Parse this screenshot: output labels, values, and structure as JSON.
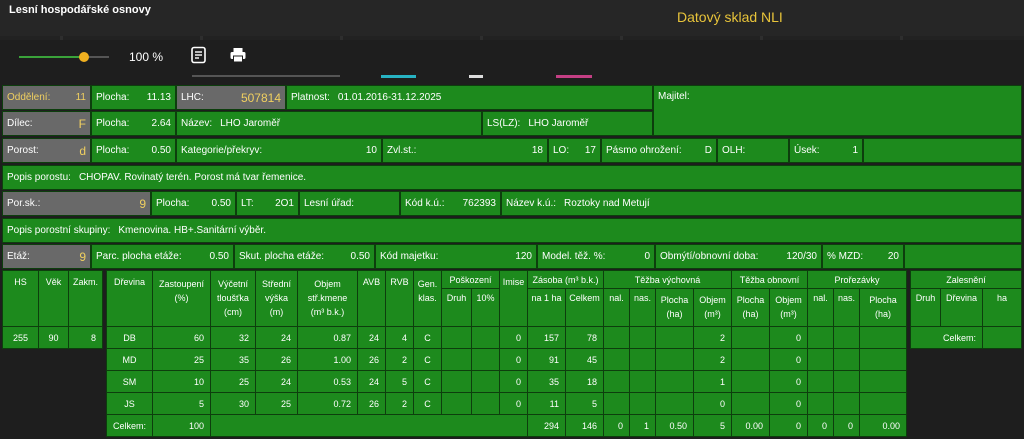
{
  "header": {
    "app_title": "Lesní hospodářské osnovy",
    "nli_title": "Datový sklad NLI"
  },
  "toolbar": {
    "zoom": "100 %",
    "zoom_fraction": 0.72,
    "notes_icon": "notes-icon",
    "print_icon": "print-icon"
  },
  "row1": {
    "oddeleni_label": "Oddělení:",
    "oddeleni": "11",
    "plocha_label": "Plocha:",
    "plocha": "11.13",
    "lhc_label": "LHC:",
    "lhc": "507814",
    "platnost_label": "Platnost:",
    "platnost": "01.01.2016-31.12.2025",
    "majitel_label": "Majitel:"
  },
  "row2": {
    "dilec_label": "Dílec:",
    "dilec": "F",
    "plocha_label": "Plocha:",
    "plocha": "2.64",
    "nazev_label": "Název:",
    "nazev": "LHO Jaroměř",
    "lslz_label": "LS(LZ):",
    "lslz": "LHO Jaroměř"
  },
  "row3": {
    "porost_label": "Porost:",
    "porost": "d",
    "plocha_label": "Plocha:",
    "plocha": "0.50",
    "kategorie_label": "Kategorie/překryv:",
    "kategorie": "10",
    "zvlst_label": "Zvl.st.:",
    "zvlst": "18",
    "lo_label": "LO:",
    "lo": "17",
    "pasmo_label": "Pásmo ohrožení:",
    "pasmo": "D",
    "olh_label": "OLH:",
    "usek_label": "Úsek:",
    "usek": "1"
  },
  "row4": {
    "popis_label": "Popis porostu:",
    "popis": "CHOPAV. Rovinatý terén. Porost má tvar řemenice."
  },
  "row5": {
    "porsk_label": "Por.sk.:",
    "porsk": "9",
    "plocha_label": "Plocha:",
    "plocha": "0.50",
    "lt_label": "LT:",
    "lt": "2O1",
    "lesni_urad_label": "Lesní úřad:",
    "kodku_label": "Kód k.ú.:",
    "kodku": "762393",
    "nazevku_label": "Název k.ú.:",
    "nazevku": "Roztoky nad Metují"
  },
  "row6": {
    "popis_skupiny_label": "Popis porostní skupiny:",
    "popis_skupiny": "Kmenovina. HB+.Sanitární výběr."
  },
  "row7": {
    "etaz_label": "Etáž:",
    "etaz": "9",
    "parc_label": "Parc. plocha etáže:",
    "parc": "0.50",
    "skut_label": "Skut. plocha etáže:",
    "skut": "0.50",
    "kod_majetku_label": "Kód majetku:",
    "kod_majetku": "120",
    "model_label": "Model. těž. %:",
    "model": "0",
    "obmyti_label": "Obmýtí/obnovní doba:",
    "obmyti": "120/30",
    "mzd_label": "% MZD:",
    "mzd": "20"
  },
  "hs_table": {
    "headers": [
      "HS",
      "Věk",
      "Zakm."
    ],
    "values": [
      "255",
      "90",
      "8"
    ]
  },
  "main_table": {
    "h_drevina": "Dřevina",
    "h_zastoupeni": "Zastoupení (%)",
    "h_vycetni": "Výčetní tloušťka (cm)",
    "h_stredni": "Střední výška (m)",
    "h_objem": "Objem stř.kmene (m³ b.k.)",
    "h_avb": "AVB",
    "h_rvb": "RVB",
    "h_gen": "Gen. klas.",
    "h_poskozeni": "Poškození",
    "h_druh": "Druh",
    "h_10": "10%",
    "h_imise": "Imise",
    "h_zasoba": "Zásoba (m³ b.k.)",
    "h_na1ha": "na 1 ha",
    "h_celkem": "Celkem",
    "h_tezba_vych": "Těžba výchovná",
    "h_nal": "nal.",
    "h_nas": "nas.",
    "h_plocha": "Plocha (ha)",
    "h_objem2": "Objem (m³)",
    "h_tezba_obn": "Těžba obnovní",
    "h_plocha2": "Plocha (ha)",
    "h_objem3": "Objem (m³)",
    "h_prorezavky": "Prořezávky",
    "h_nal2": "nal.",
    "h_nas2": "nas.",
    "h_plocha3": "Plocha (ha)",
    "rows": [
      {
        "drevina": "DB",
        "zast": "60",
        "tl": "32",
        "vys": "24",
        "obj": "0.87",
        "avb": "24",
        "rvb": "4",
        "gen": "C",
        "imise": "0",
        "ha": "157",
        "celk": "78",
        "tv_obj": "2",
        "to_obj": "0"
      },
      {
        "drevina": "MD",
        "zast": "25",
        "tl": "35",
        "vys": "26",
        "obj": "1.00",
        "avb": "26",
        "rvb": "2",
        "gen": "C",
        "imise": "0",
        "ha": "91",
        "celk": "45",
        "tv_obj": "2",
        "to_obj": "0"
      },
      {
        "drevina": "SM",
        "zast": "10",
        "tl": "25",
        "vys": "24",
        "obj": "0.53",
        "avb": "24",
        "rvb": "5",
        "gen": "C",
        "imise": "0",
        "ha": "35",
        "celk": "18",
        "tv_obj": "1",
        "to_obj": "0"
      },
      {
        "drevina": "JS",
        "zast": "5",
        "tl": "30",
        "vys": "25",
        "obj": "0.72",
        "avb": "26",
        "rvb": "2",
        "gen": "C",
        "imise": "0",
        "ha": "11",
        "celk": "5",
        "tv_obj": "0",
        "to_obj": "0"
      }
    ],
    "total": {
      "label": "Celkem:",
      "zast": "100",
      "ha": "294",
      "celk": "146",
      "tv_nal": "0",
      "tv_nas": "1",
      "tv_plocha": "0.50",
      "tv_obj": "5",
      "to_plocha": "0.00",
      "to_obj": "0",
      "pr_nal": "0",
      "pr_nas": "0",
      "pr_plocha": "0.00"
    }
  },
  "zal_table": {
    "title": "Zalesnění",
    "h_druh": "Druh",
    "h_drevina": "Dřevina",
    "h_ha": "ha",
    "celkem": "Celkem:"
  }
}
